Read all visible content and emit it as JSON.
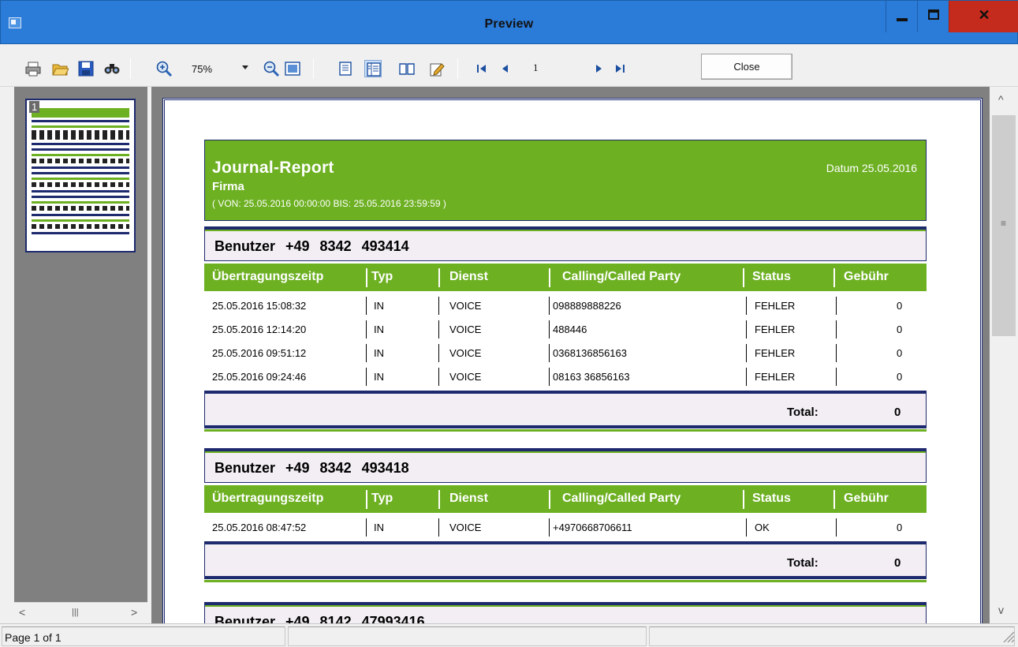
{
  "window": {
    "title": "Preview"
  },
  "toolbar": {
    "zoom_value": "75%",
    "page_value": "1",
    "close_label": "Close",
    "icons": [
      "print-icon",
      "open-icon",
      "save-icon",
      "find-icon",
      "zoom-in-icon",
      "zoom-out-icon",
      "page-width-icon",
      "single-page-icon",
      "multi-page-icon",
      "book-icon",
      "edit-icon",
      "first-page-icon",
      "prev-page-icon",
      "next-page-icon",
      "last-page-icon"
    ]
  },
  "thumbnails": [
    {
      "number": "1"
    }
  ],
  "report": {
    "title": "Journal-Report",
    "company": "Firma",
    "range": "( VON: 25.05.2016 00:00:00   BIS: 25.05.2016 23:59:59 )",
    "date": "Datum 25.05.2016",
    "columns": [
      "Übertragungszeitp",
      "Typ",
      "Dienst",
      "Calling/Called Party",
      "Status",
      "Gebühr"
    ],
    "total_label": "Total:",
    "groups": [
      {
        "user": "Benutzer   +49 8342 493414",
        "rows": [
          [
            "25.05.2016 15:08:32",
            "IN",
            "VOICE",
            "098889888226",
            "FEHLER",
            "0"
          ],
          [
            "25.05.2016 12:14:20",
            "IN",
            "VOICE",
            "488446",
            "FEHLER",
            "0"
          ],
          [
            "25.05.2016 09:51:12",
            "IN",
            "VOICE",
            "0368136856163",
            "FEHLER",
            "0"
          ],
          [
            "25.05.2016 09:24:46",
            "IN",
            "VOICE",
            "08163 36856163",
            "FEHLER",
            "0"
          ]
        ],
        "total": "0"
      },
      {
        "user": "Benutzer   +49 8342 493418",
        "rows": [
          [
            "25.05.2016 08:47:52",
            "IN",
            "VOICE",
            "+4970668706611",
            "OK",
            "0"
          ]
        ],
        "total": "0"
      },
      {
        "user": "Benutzer   +49 8142 47993416",
        "rows": [],
        "total": ""
      }
    ]
  },
  "status": {
    "page_text": "Page 1 of 1"
  },
  "colors": {
    "titlebar": "#2b7bd8",
    "close": "#c42b1c",
    "report_green": "#6db022",
    "navy": "#1d2a6e",
    "panel_gray": "#808080"
  }
}
